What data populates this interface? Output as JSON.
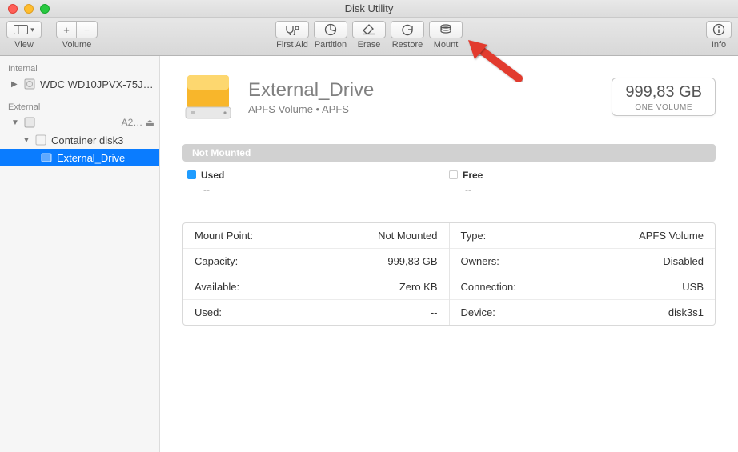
{
  "window": {
    "title": "Disk Utility"
  },
  "toolbar": {
    "view": "View",
    "volume": "Volume",
    "first_aid": "First Aid",
    "partition": "Partition",
    "erase": "Erase",
    "restore": "Restore",
    "mount": "Mount",
    "info": "Info"
  },
  "sidebar": {
    "internal_label": "Internal",
    "internal_item": "WDC WD10JPVX-75J…",
    "external_label": "External",
    "external_root": "A2…",
    "container": "Container disk3",
    "volume": "External_Drive"
  },
  "hero": {
    "title": "External_Drive",
    "subtitle": "APFS Volume • APFS",
    "capacity": "999,83 GB",
    "cap_sub": "ONE VOLUME"
  },
  "bar": {
    "label": "Not Mounted"
  },
  "legend": {
    "used_label": "Used",
    "used_val": "--",
    "free_label": "Free",
    "free_val": "--"
  },
  "info": {
    "l1k": "Mount Point:",
    "l1v": "Not Mounted",
    "l2k": "Capacity:",
    "l2v": "999,83 GB",
    "l3k": "Available:",
    "l3v": "Zero KB",
    "l4k": "Used:",
    "l4v": "--",
    "r1k": "Type:",
    "r1v": "APFS Volume",
    "r2k": "Owners:",
    "r2v": "Disabled",
    "r3k": "Connection:",
    "r3v": "USB",
    "r4k": "Device:",
    "r4v": "disk3s1"
  }
}
